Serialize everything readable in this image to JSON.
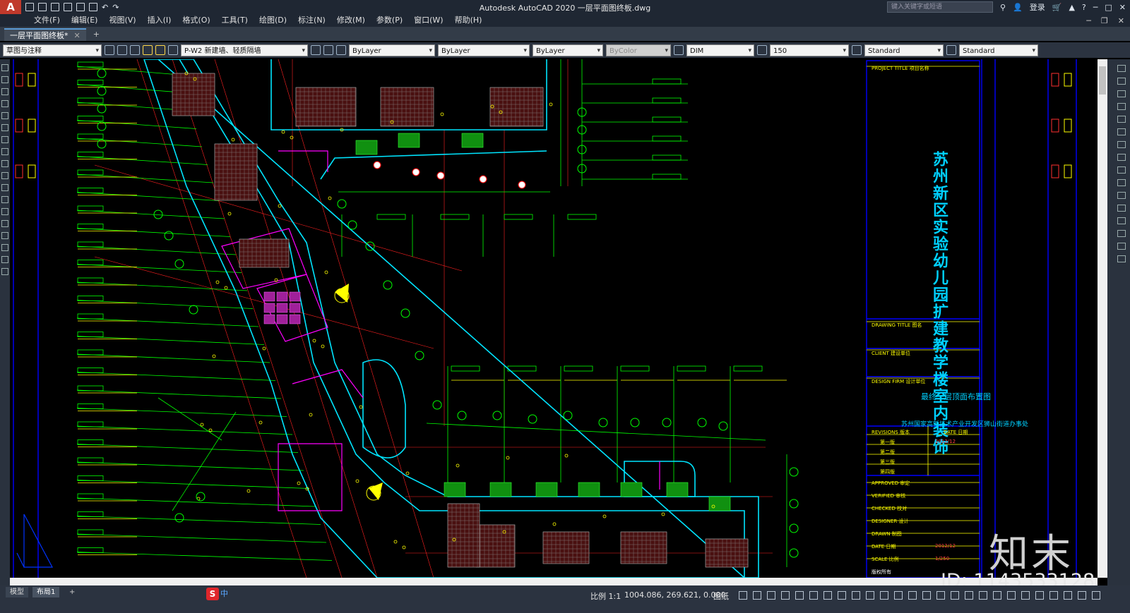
{
  "app": {
    "logo_letter": "A",
    "title": "Autodesk AutoCAD 2020    一层平面图终板.dwg",
    "search_placeholder": "键入关键字或短语",
    "login_label": "登录"
  },
  "menu": [
    "文件(F)",
    "编辑(E)",
    "视图(V)",
    "插入(I)",
    "格式(O)",
    "工具(T)",
    "绘图(D)",
    "标注(N)",
    "修改(M)",
    "参数(P)",
    "窗口(W)",
    "帮助(H)"
  ],
  "tabs": [
    {
      "label": "一层平面图终板*"
    }
  ],
  "toolbar": {
    "workspace": "草图与注释",
    "layer": "P-W2 新建墙、轻质隔墙",
    "color": "ByLayer",
    "linetype": "ByLayer",
    "lineweight": "ByLayer",
    "plotstyle": "ByColor",
    "dimstyle": "DIM",
    "scale": "150",
    "textstyle": "Standard",
    "tablestyle": "Standard"
  },
  "drawing": {
    "project_title_label": "PROJECT TITLE  项目名称",
    "project_title": "苏州新区实验幼儿园扩建教学楼室内装饰",
    "drawing_title_label": "DRAWING TITLE  图名",
    "drawing_title": "最终一层顶面布置图",
    "client_label": "CLIENT  建设单位",
    "client": "苏州国家高新技术产业开发区狮山街道办事处",
    "design_firm_label": "DESIGN FIRM  设计单位",
    "revisions_label": "REVISIONS  版本",
    "date_label": "DATE  日期",
    "revisions": [
      "第一版",
      "第二版",
      "第三版",
      "第四版"
    ],
    "revision_date": "2012/12",
    "approved": "APPROVED  审定",
    "verified": "VERIFIED  审核",
    "checked": "CHECKED  校对",
    "designer": "DESIGNER  设计",
    "drawn": "DRAWN  制图",
    "date": "DATE  日期",
    "date_value": "2012/12",
    "scale": "SCALE  比例",
    "scale_value": "1/250",
    "copyright": "版权所有"
  },
  "layout_tabs": [
    "模型",
    "布局1",
    "+"
  ],
  "status": {
    "scale": "比例 1:1",
    "coords": "1004.086, 269.621, 0.000",
    "space": "图纸"
  },
  "watermark": {
    "logo": "知末",
    "id": "ID: 1143533128"
  },
  "colors": {
    "background": "#000000",
    "wall_cyan": "#00ffff",
    "dim_green": "#00ff00",
    "annotation_yellow": "#ffff00",
    "grid_red": "#ff0000",
    "room_magenta": "#ff00ff",
    "title_blue": "#00d0ff"
  }
}
